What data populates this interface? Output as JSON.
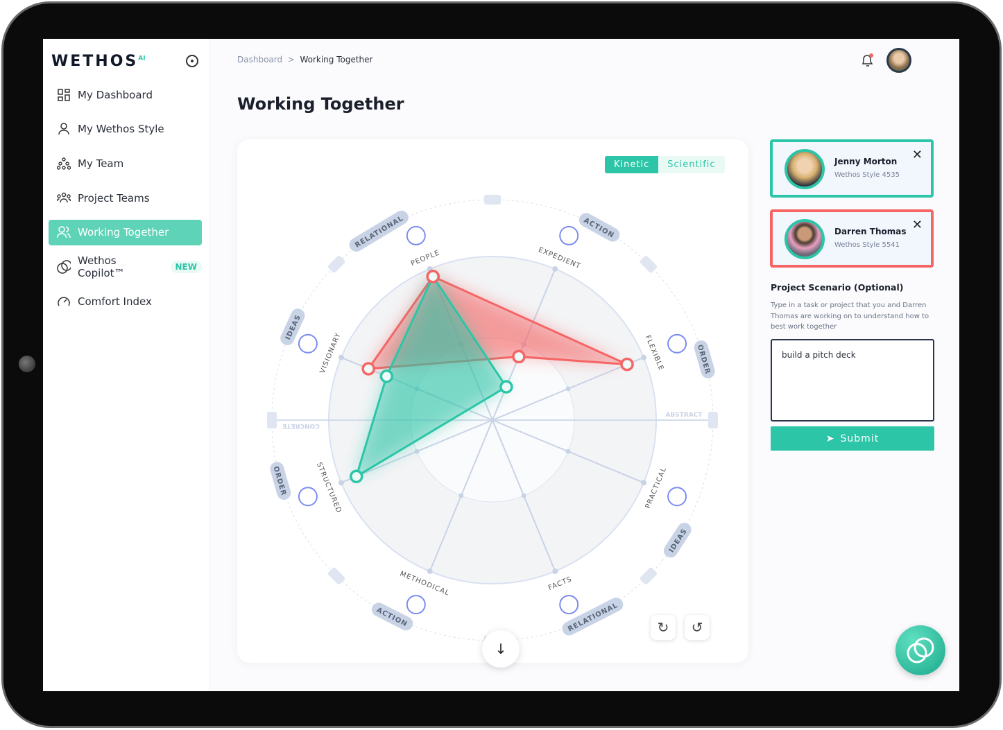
{
  "brand": {
    "logo": "WETHOS",
    "logo_suffix": "AI"
  },
  "sidebar": {
    "items": [
      {
        "label": "My Dashboard",
        "icon": "grid-icon"
      },
      {
        "label": "My Wethos Style",
        "icon": "user-icon"
      },
      {
        "label": "My Team",
        "icon": "team-tree-icon"
      },
      {
        "label": "Project Teams",
        "icon": "group-icon"
      },
      {
        "label": "Working Together",
        "icon": "users-icon",
        "active": true
      },
      {
        "label": "Wethos Copilot™",
        "icon": "copilot-icon",
        "badge": "NEW"
      },
      {
        "label": "Comfort Index",
        "icon": "gauge-icon"
      }
    ]
  },
  "breadcrumb": {
    "parent": "Dashboard",
    "separator": ">",
    "current": "Working Together"
  },
  "page_title": "Working Together",
  "toggle": {
    "options": [
      "Kinetic",
      "Scientific"
    ],
    "selected": "Kinetic"
  },
  "colors": {
    "accent": "#2cc5a7",
    "jenny": "#2cc5a7",
    "darren": "#f56565"
  },
  "chart_data": {
    "type": "radar",
    "axes": [
      "PEOPLE",
      "EXPEDIENT",
      "FLEXIBLE",
      "PRACTICAL",
      "FACTS",
      "METHODICAL",
      "STRUCTURED",
      "VISIONARY"
    ],
    "outer_labels": [
      "RELATIONAL",
      "ACTION",
      "ORDER",
      "IDEAS",
      "RELATIONAL",
      "ACTION",
      "ORDER",
      "IDEAS"
    ],
    "horizontal_labels": {
      "left": "CONCRETE",
      "right": "ABSTRACT"
    },
    "range": [
      0,
      1
    ],
    "series": [
      {
        "name": "Jenny Morton",
        "color": "#2cc5a7",
        "points": [
          {
            "axis": "PEOPLE",
            "value": 0.95
          },
          {
            "axis": "EXPEDIENT",
            "value": 0.22
          },
          {
            "axis": "STRUCTURED",
            "value": 0.9
          },
          {
            "axis": "VISIONARY",
            "value": 0.7
          }
        ]
      },
      {
        "name": "Darren Thomas",
        "color": "#f56565",
        "points": [
          {
            "axis": "PEOPLE",
            "value": 0.95
          },
          {
            "axis": "FLEXIBLE",
            "value": 0.89
          },
          {
            "axis": "EXPEDIENT",
            "value": 0.42
          },
          {
            "axis": "VISIONARY",
            "value": 0.82
          }
        ]
      }
    ]
  },
  "people": [
    {
      "name": "Jenny Morton",
      "style": "Wethos Style 4535",
      "border": "#2cc5a7"
    },
    {
      "name": "Darren Thomas",
      "style": "Wethos Style 5541",
      "border": "#f56565"
    }
  ],
  "scenario": {
    "title": "Project Scenario (Optional)",
    "description": "Type in a task or project that you and Darren Thomas are working on to understand how to best work together",
    "value": "build a pitch deck",
    "submit": "Submit"
  }
}
